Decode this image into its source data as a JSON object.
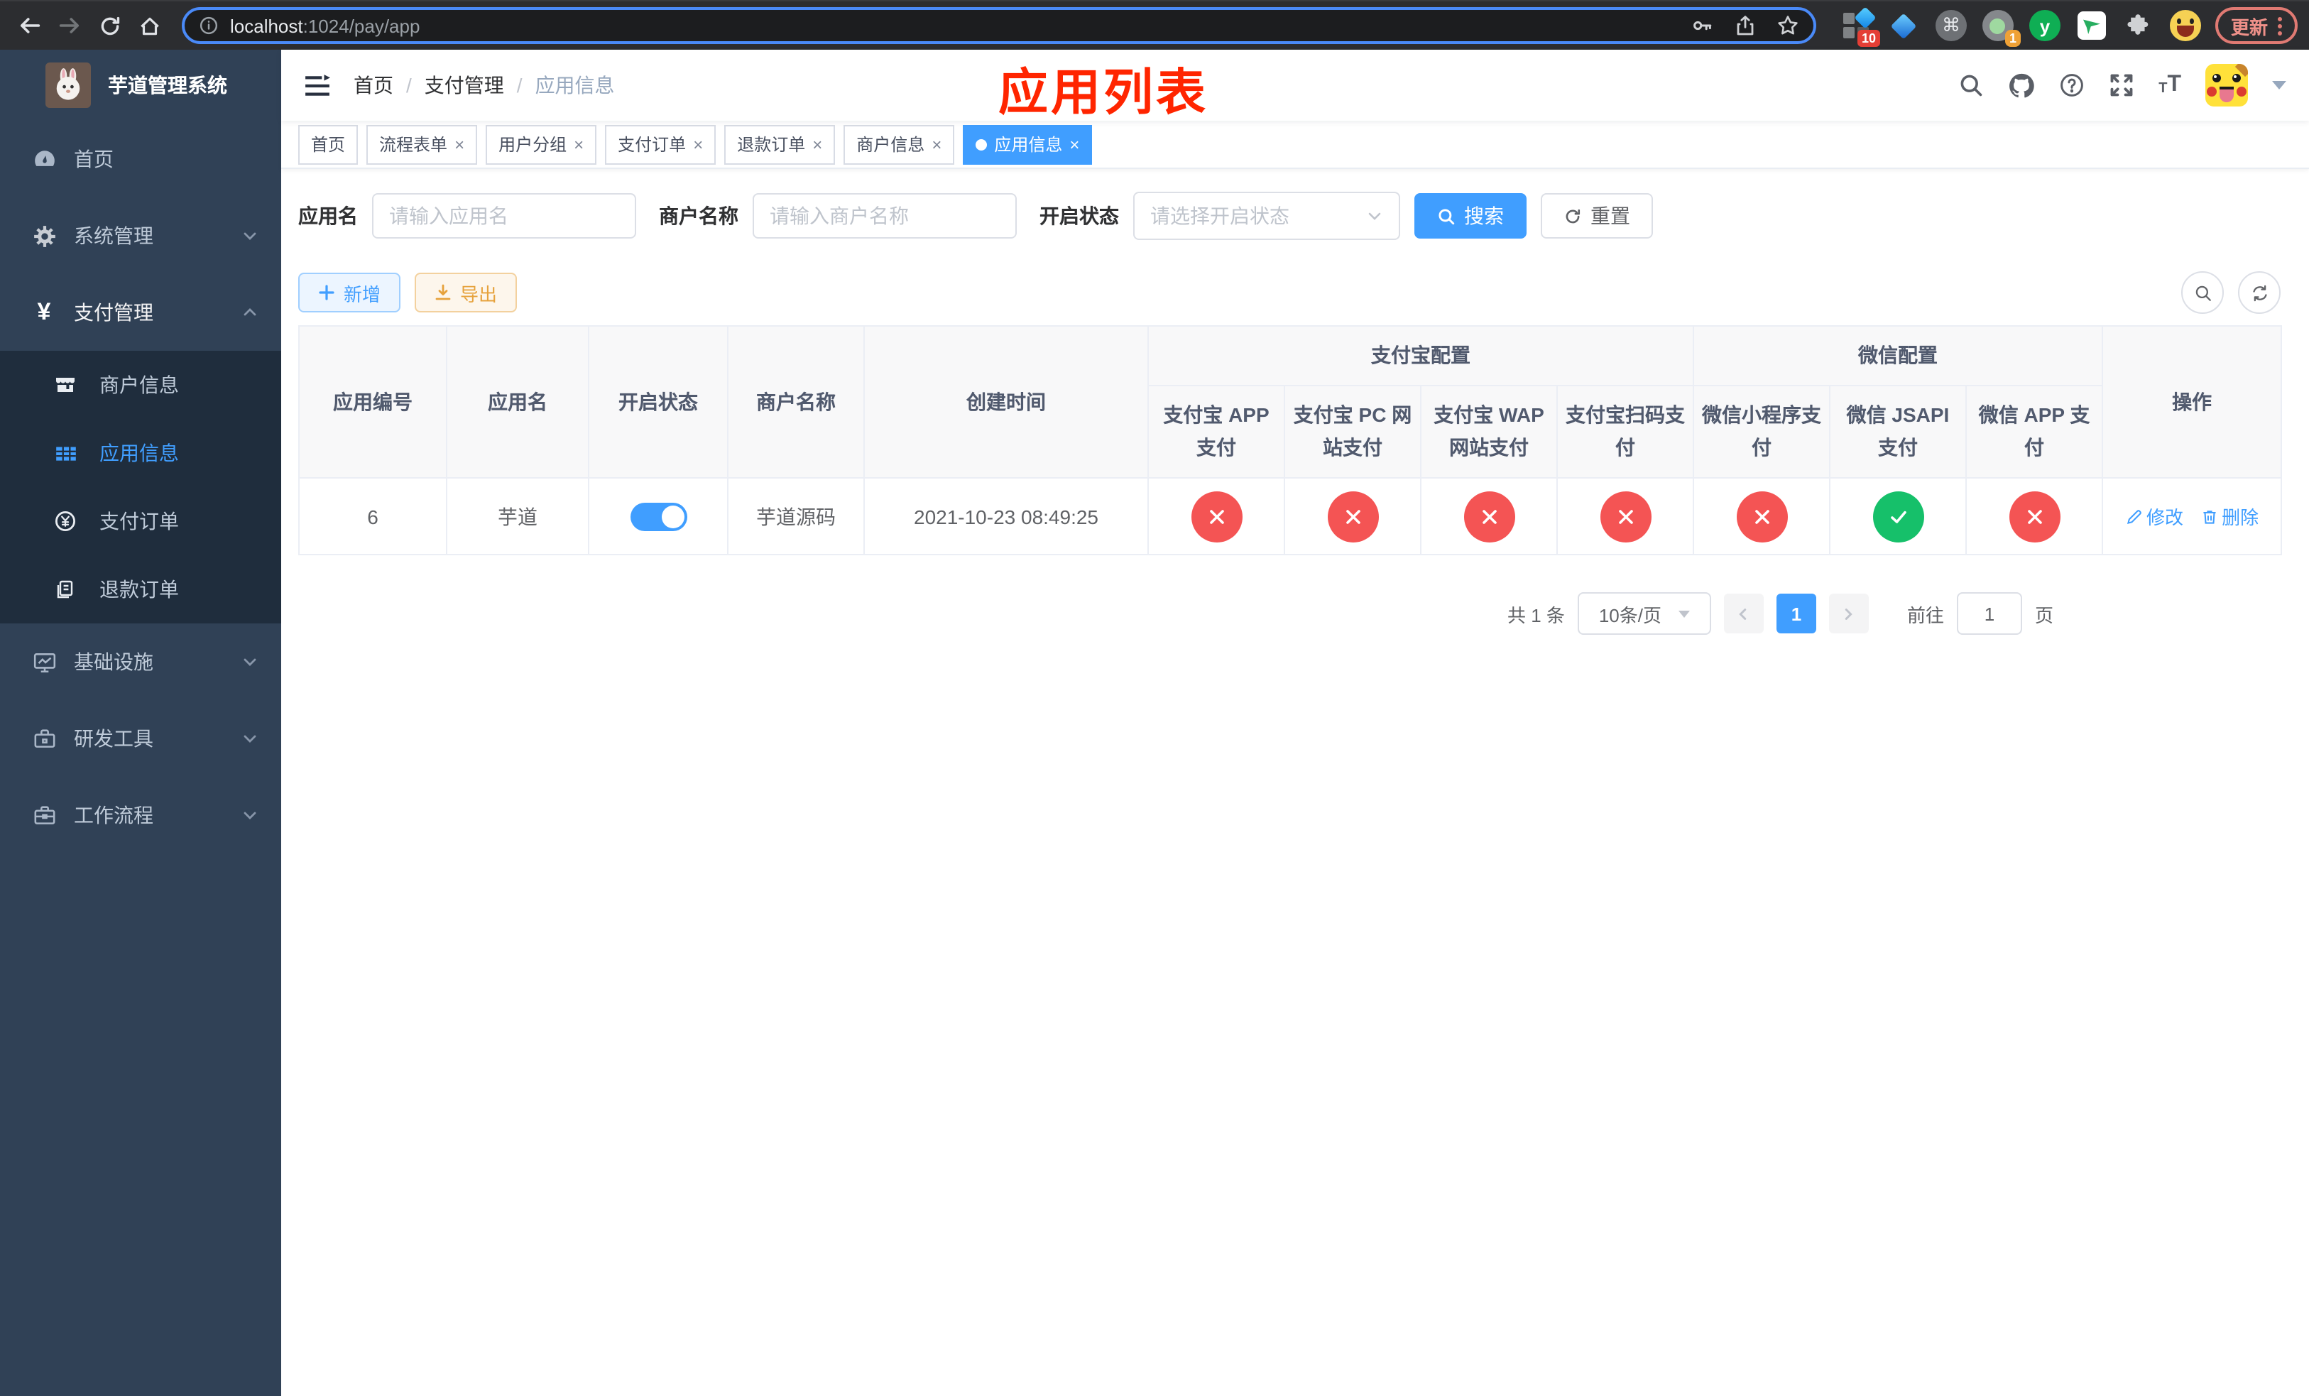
{
  "browser": {
    "url": {
      "host": "localhost",
      "path": ":1024/pay/app"
    },
    "update_label": "更新",
    "ext_badge_grid": "10",
    "ext_badge_profile": "1",
    "ext_y_label": "y"
  },
  "sidebar": {
    "title": "芋道管理系统",
    "menu": [
      {
        "label": "首页"
      },
      {
        "label": "系统管理"
      },
      {
        "label": "支付管理"
      },
      {
        "label": "基础设施"
      },
      {
        "label": "研发工具"
      },
      {
        "label": "工作流程"
      }
    ],
    "submenu": [
      {
        "label": "商户信息"
      },
      {
        "label": "应用信息"
      },
      {
        "label": "支付订单"
      },
      {
        "label": "退款订单"
      }
    ]
  },
  "header": {
    "breadcrumb": [
      "首页",
      "支付管理",
      "应用信息"
    ],
    "annotation": "应用列表"
  },
  "tabs": [
    {
      "label": "首页"
    },
    {
      "label": "流程表单"
    },
    {
      "label": "用户分组"
    },
    {
      "label": "支付订单"
    },
    {
      "label": "退款订单"
    },
    {
      "label": "商户信息"
    },
    {
      "label": "应用信息"
    }
  ],
  "filters": {
    "app_name": {
      "label": "应用名",
      "placeholder": "请输入应用名"
    },
    "merchant_name": {
      "label": "商户名称",
      "placeholder": "请输入商户名称"
    },
    "status": {
      "label": "开启状态",
      "placeholder": "请选择开启状态"
    },
    "search_label": "搜索",
    "reset_label": "重置"
  },
  "toolbar": {
    "add_label": "新增",
    "export_label": "导出"
  },
  "table": {
    "columns": [
      "应用编号",
      "应用名",
      "开启状态",
      "商户名称",
      "创建时间"
    ],
    "groups": [
      {
        "label": "支付宝配置",
        "children": [
          "支付宝 APP 支付",
          "支付宝 PC 网站支付",
          "支付宝 WAP 网站支付",
          "支付宝扫码支付"
        ]
      },
      {
        "label": "微信配置",
        "children": [
          "微信小程序支付",
          "微信 JSAPI 支付",
          "微信 APP 支付"
        ]
      }
    ],
    "ops_label": "操作",
    "rows": [
      {
        "id": "6",
        "name": "芋道",
        "enabled": true,
        "merchant": "芋道源码",
        "created": "2021-10-23 08:49:25",
        "channels": [
          "off",
          "off",
          "off",
          "off",
          "off",
          "on",
          "off"
        ],
        "edit_label": "修改",
        "delete_label": "删除"
      }
    ]
  },
  "pagination": {
    "total_text": "共 1 条",
    "page_size": "10条/页",
    "current_page": "1",
    "goto_label": "前往",
    "goto_value": "1",
    "page_unit": "页"
  },
  "colors": {
    "primary": "#409eff",
    "danger": "#f45454",
    "success": "#16c06a",
    "annotation": "#ff2500"
  }
}
